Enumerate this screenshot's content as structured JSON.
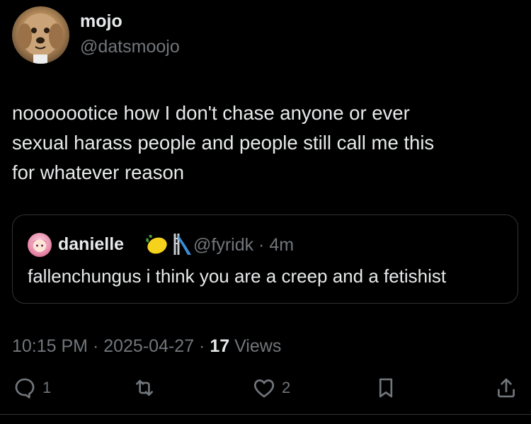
{
  "author": {
    "display_name": "mojo",
    "handle": "@datsmoojo",
    "avatar_icon": "dog-avatar"
  },
  "tweet": {
    "text": "nooooootice how I don't chase anyone or ever\nsexual harass people  and people still call me this\nfor whatever reason"
  },
  "quote": {
    "display_name": "danielle",
    "emojis": [
      "lemon-emoji",
      "slide-emoji"
    ],
    "handle_time": "@fyridk · 4m",
    "text": "fallenchungus i think you are a creep and a fetishist"
  },
  "meta": {
    "timestamp": "10:15 PM · 2025-04-27 · ",
    "views_count": "17",
    "views_label": " Views"
  },
  "actions": {
    "reply_count": "1",
    "like_count": "2"
  }
}
